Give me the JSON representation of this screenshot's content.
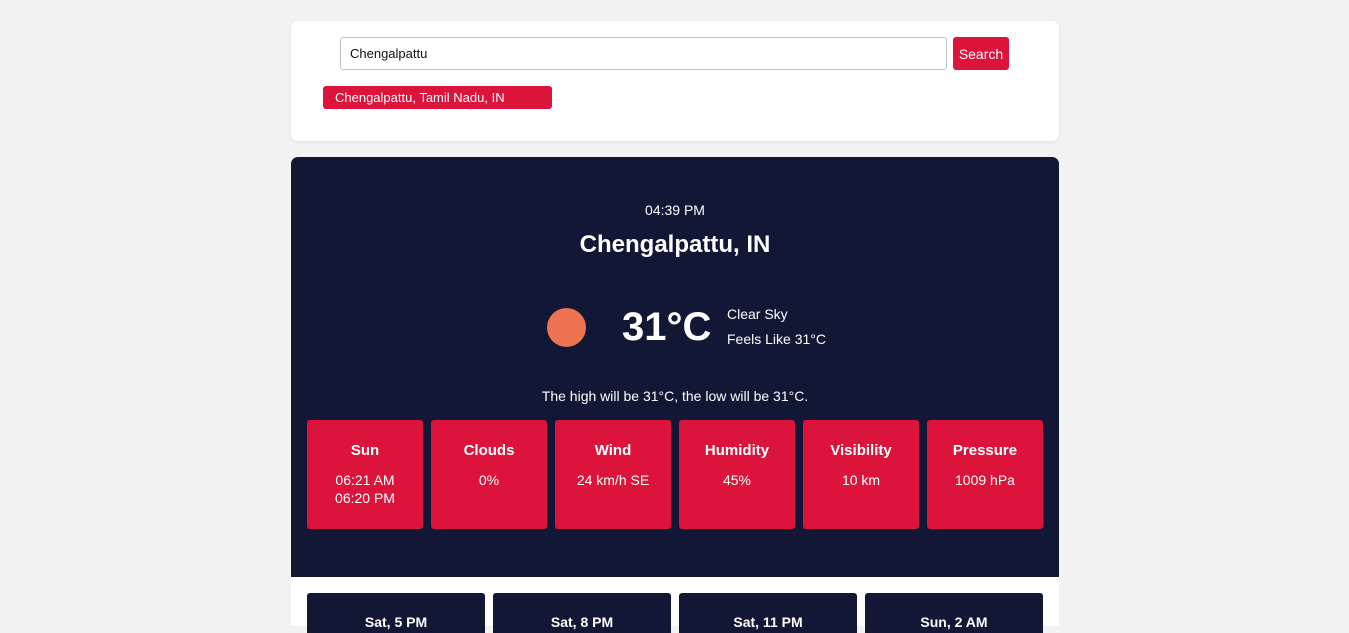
{
  "search": {
    "value": "Chengalpattu",
    "button_label": "Search",
    "suggestions": [
      "Chengalpattu, Tamil Nadu, IN"
    ]
  },
  "current": {
    "time": "04:39 PM",
    "city": "Chengalpattu, IN",
    "temperature": "31°C",
    "condition": "Clear Sky",
    "feels_like": "Feels Like 31°C",
    "high_low": "The high will be 31°C, the low will be 31°C.",
    "icon": "sun-icon"
  },
  "stats": [
    {
      "title": "Sun",
      "value": "06:21 AM\n06:20 PM"
    },
    {
      "title": "Clouds",
      "value": "0%"
    },
    {
      "title": "Wind",
      "value": "24 km/h SE"
    },
    {
      "title": "Humidity",
      "value": "45%"
    },
    {
      "title": "Visibility",
      "value": "10 km"
    },
    {
      "title": "Pressure",
      "value": "1009 hPa"
    }
  ],
  "forecast": [
    {
      "label": "Sat, 5 PM"
    },
    {
      "label": "Sat, 8 PM"
    },
    {
      "label": "Sat, 11 PM"
    },
    {
      "label": "Sun, 2 AM"
    }
  ],
  "colors": {
    "accent": "#dc143c",
    "panel": "#121736",
    "sun": "#ee7352",
    "background": "#f3f2f2"
  }
}
